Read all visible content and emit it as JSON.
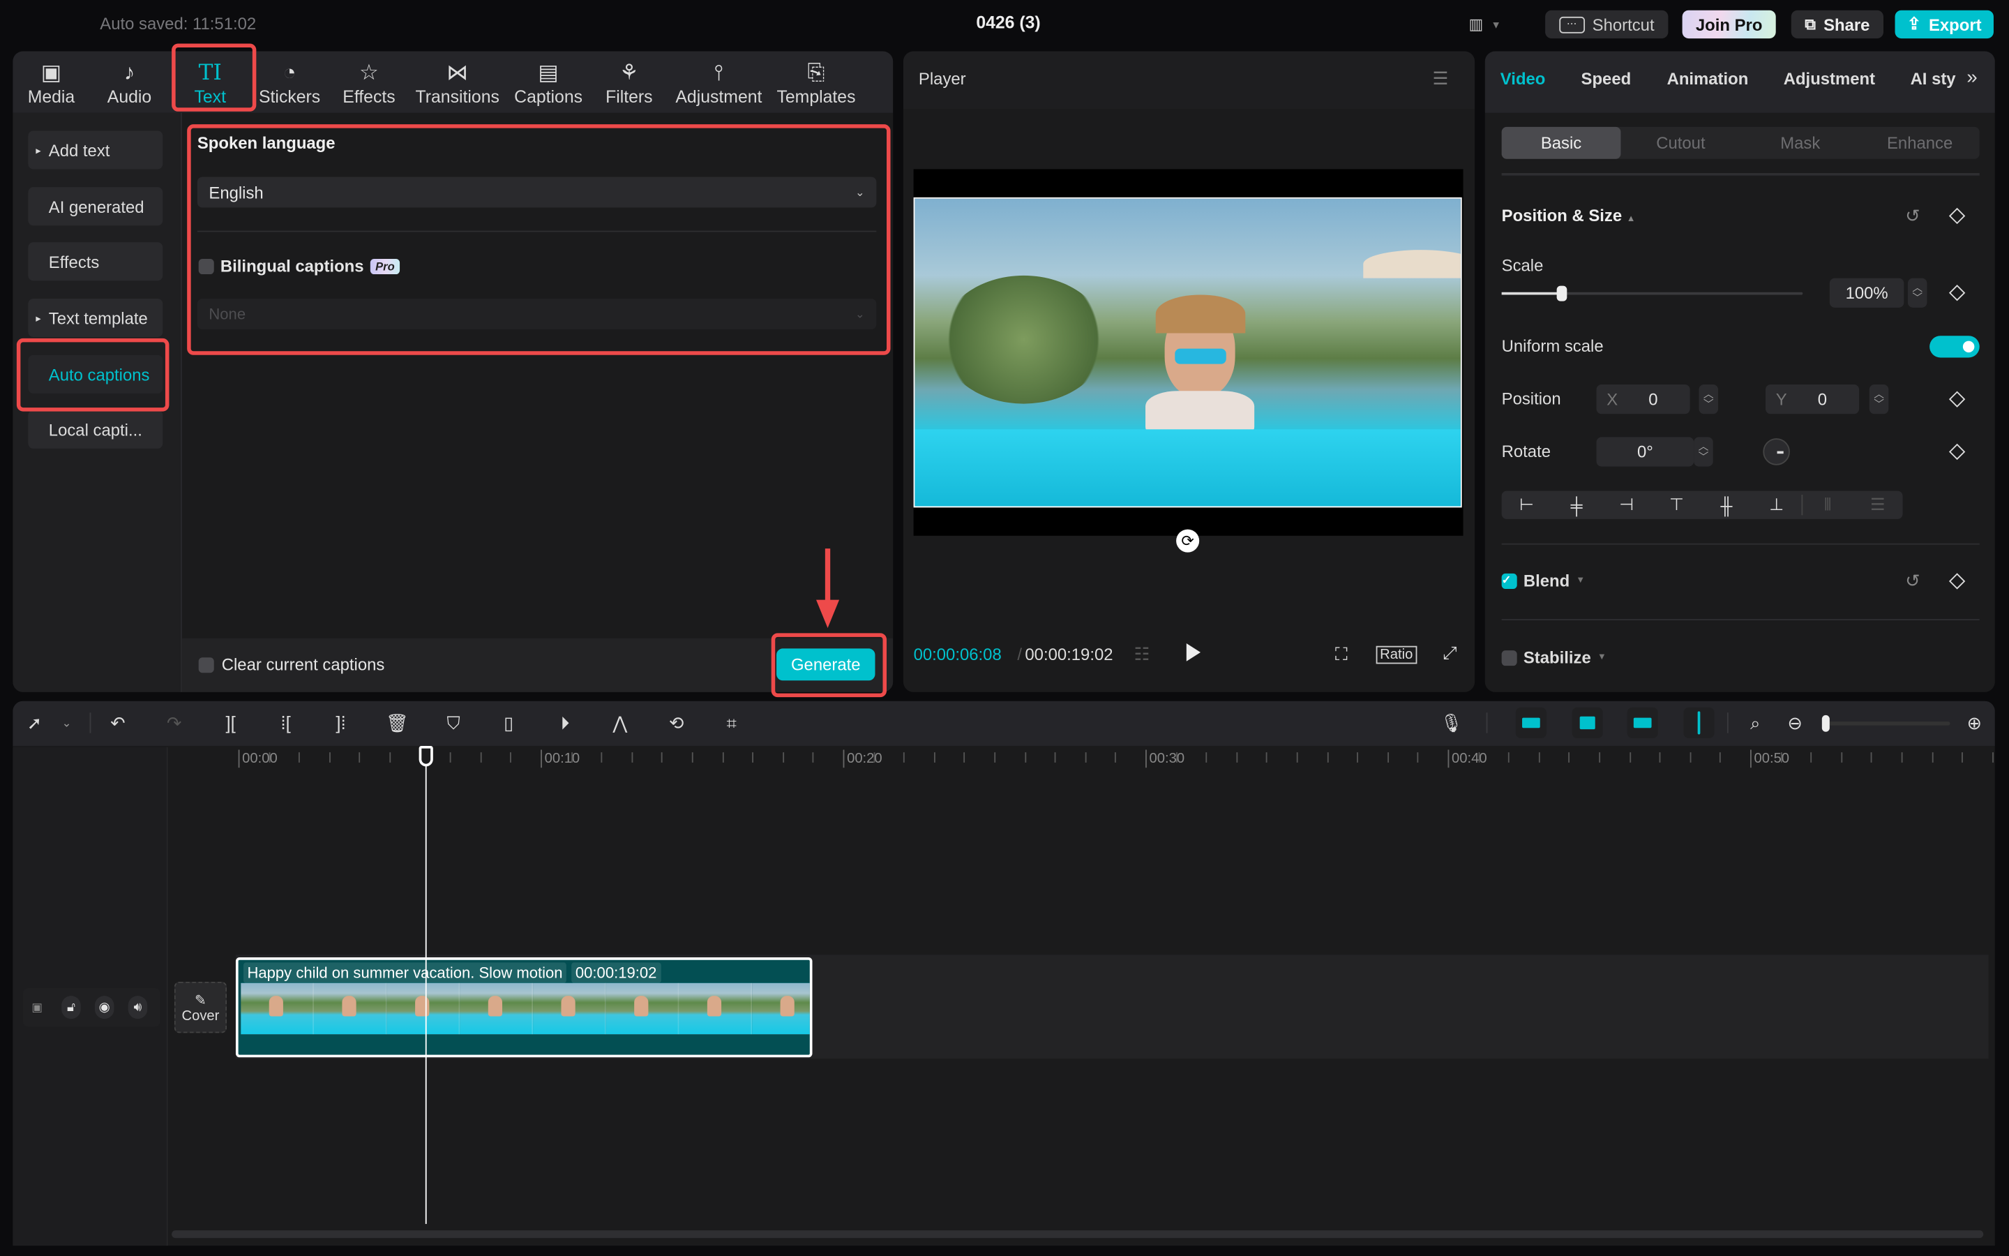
{
  "topbar": {
    "autosave": "Auto saved: 11:51:02",
    "title": "0426 (3)",
    "shortcut": "Shortcut",
    "join_pro": "Join Pro",
    "share": "Share",
    "export": "Export"
  },
  "media_tabs": [
    {
      "label": "Media",
      "icon": "media-icon"
    },
    {
      "label": "Audio",
      "icon": "audio-icon"
    },
    {
      "label": "Text",
      "icon": "text-icon",
      "active": true
    },
    {
      "label": "Stickers",
      "icon": "stickers-icon"
    },
    {
      "label": "Effects",
      "icon": "effects-icon"
    },
    {
      "label": "Transitions",
      "icon": "transitions-icon"
    },
    {
      "label": "Captions",
      "icon": "captions-icon"
    },
    {
      "label": "Filters",
      "icon": "filters-icon"
    },
    {
      "label": "Adjustment",
      "icon": "adjustment-icon"
    },
    {
      "label": "Templates",
      "icon": "templates-icon"
    }
  ],
  "text_sidebar": [
    {
      "label": "Add text",
      "caret": true
    },
    {
      "label": "AI generated"
    },
    {
      "label": "Effects"
    },
    {
      "label": "Text template",
      "caret": true
    },
    {
      "label": "Auto captions",
      "active": true
    },
    {
      "label": "Local capti..."
    }
  ],
  "captions": {
    "spoken_language_label": "Spoken language",
    "spoken_language_value": "English",
    "bilingual_label": "Bilingual captions",
    "pro_badge": "Pro",
    "bilingual_value": "None",
    "clear_label": "Clear current captions",
    "generate": "Generate"
  },
  "player": {
    "title": "Player",
    "current_time": "00:00:06:08",
    "total_time": "00:00:19:02",
    "ratio": "Ratio"
  },
  "inspector": {
    "tabs": [
      "Video",
      "Speed",
      "Animation",
      "Adjustment",
      "AI sty"
    ],
    "subtabs": [
      "Basic",
      "Cutout",
      "Mask",
      "Enhance"
    ],
    "position_size": "Position & Size",
    "scale_label": "Scale",
    "scale_value": "100%",
    "scale_fraction": 0.2,
    "uniform_scale": "Uniform scale",
    "uniform_scale_on": true,
    "position_label": "Position",
    "x_label": "X",
    "x_value": "0",
    "y_label": "Y",
    "y_value": "0",
    "rotate_label": "Rotate",
    "rotate_value": "0°",
    "blend": "Blend",
    "blend_checked": true,
    "stabilize": "Stabilize",
    "stabilize_checked": false
  },
  "timeline": {
    "ruler_labels": [
      "00:00",
      "00:10",
      "00:20",
      "00:30",
      "00:40",
      "00:50"
    ],
    "playhead_seconds": 6.27,
    "cover_label": "Cover",
    "clip_title": "Happy child on summer vacation. Slow motion",
    "clip_duration": "00:00:19:02",
    "clip_seconds": 19.07
  },
  "colors": {
    "accent": "#00c1cd",
    "highlight": "#ee4a4a",
    "panel": "#1b1b1c",
    "clip": "#034f53"
  }
}
